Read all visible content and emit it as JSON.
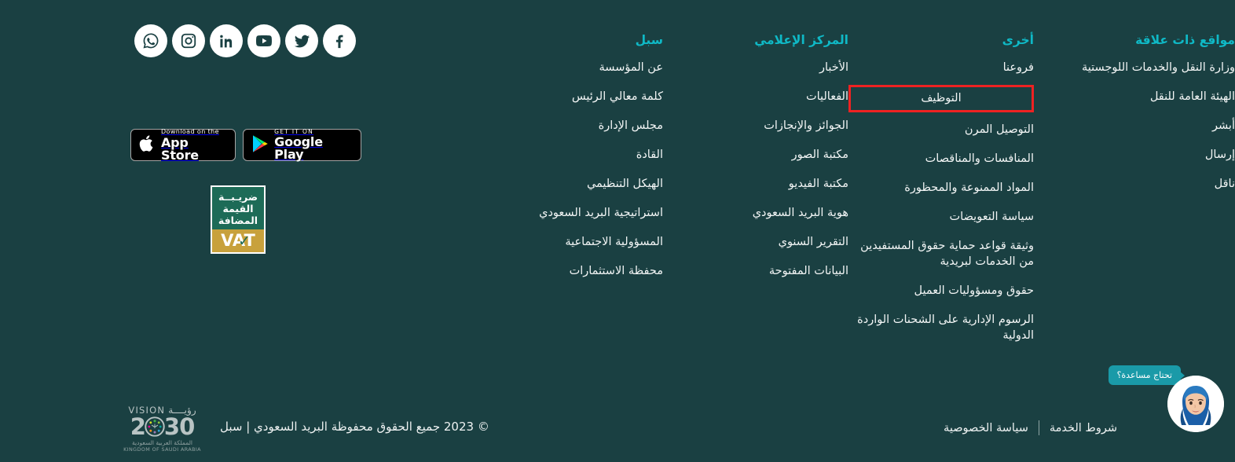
{
  "site": {
    "background_color": "#1a4042",
    "heading_color": "#0fb9c6",
    "highlight_color": "#ee2222"
  },
  "social": {
    "items": [
      {
        "name": "whatsapp-icon",
        "label": "WhatsApp"
      },
      {
        "name": "instagram-icon",
        "label": "Instagram"
      },
      {
        "name": "linkedin-icon",
        "label": "LinkedIn"
      },
      {
        "name": "youtube-icon",
        "label": "YouTube"
      },
      {
        "name": "twitter-icon",
        "label": "Twitter"
      },
      {
        "name": "facebook-icon",
        "label": "Facebook"
      }
    ]
  },
  "app_badges": {
    "appstore": {
      "small": "Download on the",
      "big": "App Store"
    },
    "googleplay": {
      "small": "GET IT ON",
      "big": "Google Play"
    }
  },
  "vat_logo": {
    "line1": "ضريـبــة",
    "line2": "القيمة",
    "line3": "المضافة",
    "acronym": "VAT"
  },
  "columns": [
    {
      "id": "sabl",
      "heading": "سبل",
      "links": [
        "عن المؤسسة",
        "كلمة معالي الرئيس",
        "مجلس الإدارة",
        "القادة",
        "الهيكل التنظيمي",
        "استراتيجية البريد السعودي",
        "المسؤولية الاجتماعية",
        "محفظة الاستثمارات"
      ]
    },
    {
      "id": "media-center",
      "heading": "المركز الإعلامي",
      "links": [
        "الأخبار",
        "الفعاليات",
        "الجوائز والإنجازات",
        "مكتبة الصور",
        "مكتبة الفيديو",
        "هوية البريد السعودي",
        "التقرير السنوي",
        "البيانات المفتوحة"
      ]
    },
    {
      "id": "other",
      "heading": "أخرى",
      "links": [
        "فروعنا",
        "التوظيف",
        "التوصيل المرن",
        "المنافسات والمناقصات",
        "المواد الممنوعة والمحظورة",
        "سياسة التعويضات",
        "وثيقة قواعد حماية حقوق المستفيدين من الخدمات لبريدية",
        "حقوق ومسؤوليات العميل",
        "الرسوم الإدارية على الشحنات الواردة الدولية"
      ],
      "highlighted_index": 1
    },
    {
      "id": "related-sites",
      "heading": "مواقع ذات علاقة",
      "links": [
        "وزارة النقل والخدمات اللوجستية",
        "الهيئة العامة للنقل",
        "أبشر",
        "إرسال",
        "ناقل"
      ]
    }
  ],
  "vision2030": {
    "word_en": "VISION",
    "word_ar": "رؤيــــة",
    "num_left": "2",
    "num_right": "30",
    "kingdom_ar": "المملكة العربية السعودية",
    "kingdom_en": "KINGDOM OF SAUDI ARABIA"
  },
  "bottom": {
    "copyright": "© 2023 جميع الحقوق محفوظة البريد السعودي | سبل",
    "terms": "شروط الخدمة",
    "privacy": "سياسة الخصوصية"
  },
  "chat": {
    "bubble_text": "تحتاج مساعدة؟",
    "avatar_name": "agent-avatar"
  }
}
